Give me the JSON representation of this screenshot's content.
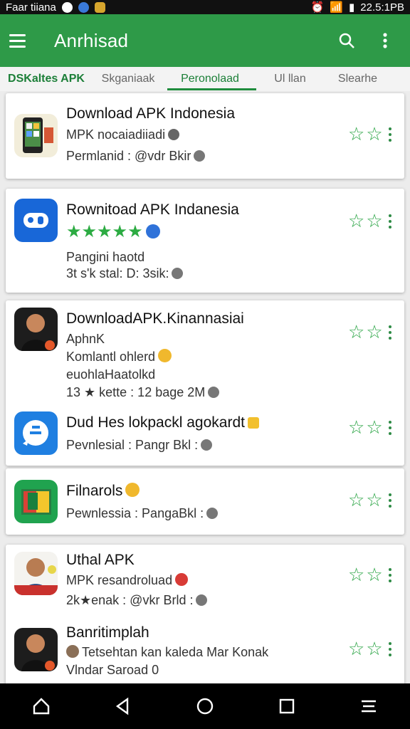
{
  "status_bar": {
    "left_text": "Faar tiiana",
    "time": "22.5:1PB"
  },
  "app_bar": {
    "title": "Anrhisad",
    "color": "#2e9a48"
  },
  "tabs": [
    {
      "label": "DSKaltes APK",
      "active": false
    },
    {
      "label": "Skganiaak",
      "active": false
    },
    {
      "label": "Peronolaad",
      "active": true
    },
    {
      "label": "Ul llan",
      "active": false
    },
    {
      "label": "Slearhe",
      "active": false
    }
  ],
  "items": [
    {
      "title": "Download APK Indonesia",
      "line1": "MPK nocaiadiiadi",
      "line2": "Permlanid : @vdr Bkir",
      "icon": "phone-screenshot-icon"
    },
    {
      "title": "Rownitoad APK Indanesia",
      "line1": "★★★★★",
      "line2": "Pangini haotd",
      "line3": "3t s'k stal: D: 3sik:",
      "icon": "blue-app-icon",
      "rating": 5
    },
    {
      "title": "DownloadAPK.Kinannasiai",
      "line1": "AphnK",
      "line2": "Komlantl ohlerd",
      "line3": "euohlaHaatolkd",
      "line4": "13 ★ kette : 12 bage 2M",
      "icon": "person-avatar-icon"
    },
    {
      "title": "Dud Hes lokpackl agokardt",
      "line1": "Pevnlesial : Pangr Bkl :",
      "icon": "chat-bubble-icon"
    },
    {
      "title": "Filnarols",
      "line1": "Pewnlessia : PangaBkl :",
      "icon": "gallery-app-icon"
    },
    {
      "title": "Uthal APK",
      "line1": "MPK resandroluad",
      "line2": "2k★enak : @vkr Brld :",
      "icon": "person-portrait-icon"
    },
    {
      "title": "Banritimplah",
      "line1": "Tetsehtan kan kaleda Mar Konak",
      "line2": "Vlndar Saroad  0",
      "icon": "person-avatar-icon"
    }
  ],
  "nav": [
    "home-button",
    "back-button",
    "circle-home-button",
    "recent-apps-button",
    "menu-lines-button"
  ]
}
